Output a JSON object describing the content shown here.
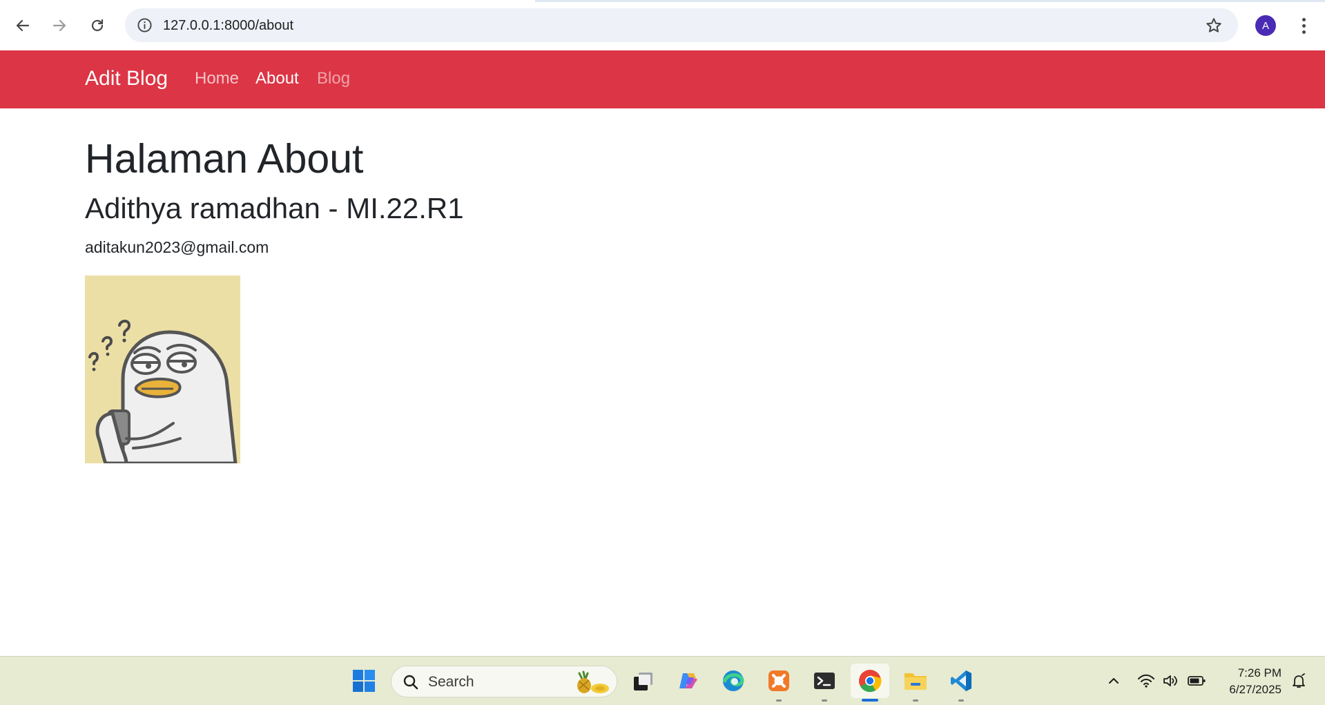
{
  "browser": {
    "url_host": "127.0.0.1",
    "url_path": ":8000/about",
    "avatar_letter": "A"
  },
  "navbar": {
    "brand": "Adit Blog",
    "links": [
      {
        "label": "Home",
        "state": "default"
      },
      {
        "label": "About",
        "state": "active"
      },
      {
        "label": "Blog",
        "state": "muted"
      }
    ],
    "background_color": "#dc3545"
  },
  "main": {
    "title": "Halaman About",
    "subtitle": "Adithya ramadhan - MI.22.R1",
    "email": "aditakun2023@gmail.com",
    "image_icon": "duck-thinking-phone"
  },
  "taskbar": {
    "search_placeholder": "Search",
    "apps": [
      "start-icon",
      "task-view-icon",
      "copilot-icon",
      "edge-icon",
      "xampp-icon",
      "terminal-icon",
      "chrome-icon",
      "file-explorer-icon",
      "vscode-icon"
    ],
    "time": "7:26 PM",
    "date": "6/27/2025"
  }
}
